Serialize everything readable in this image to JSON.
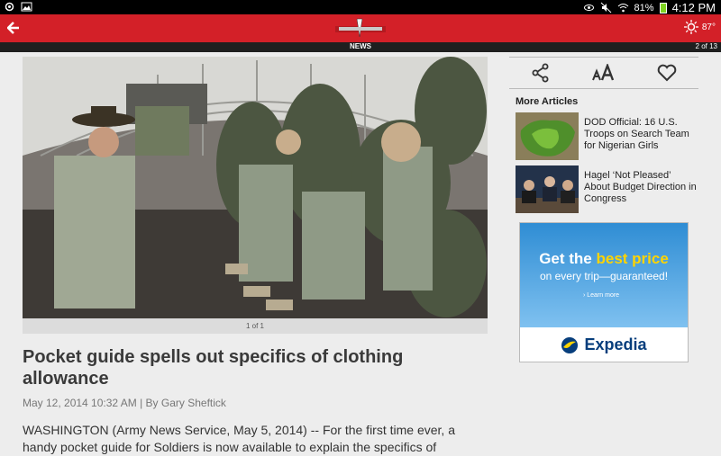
{
  "status_bar": {
    "battery": "81%",
    "time": "4:12 PM"
  },
  "header": {
    "weather_temp": "87°",
    "section": "NEWS",
    "pager": "2 of 13"
  },
  "article": {
    "photo_counter": "1 of 1",
    "title": "Pocket guide spells out specifics of clothing allowance",
    "meta": "May 12, 2014 10:32 AM | By Gary Sheftick",
    "body_lines": [
      "WASHINGTON (Army News Service, May 5, 2014) -- For the first time ever, a",
      "handy pocket guide for Soldiers is now available to explain the specifics of"
    ]
  },
  "rail": {
    "more_label": "More Articles",
    "items": [
      {
        "title": "DOD Official: 16 U.S. Troops on Search Team for Nigerian Girls"
      },
      {
        "title": "Hagel ‘Not Pleased’ About Budget Direction in Congress"
      }
    ]
  },
  "ad": {
    "headline_a": "Get the ",
    "headline_b": "best price",
    "subline": "on every trip—guaranteed!",
    "link": "› Learn more",
    "brand": "Expedia"
  }
}
